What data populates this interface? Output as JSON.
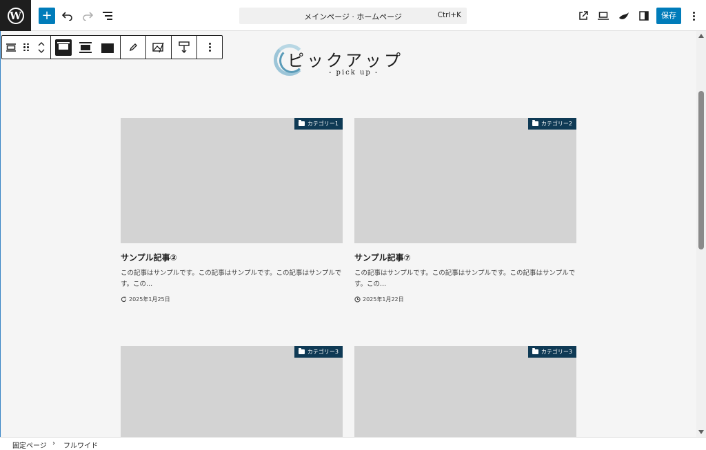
{
  "topbar": {
    "document_title": "メインページ · ホームページ",
    "shortcut": "Ctrl+K",
    "save_label": "保存"
  },
  "block_toolbar": {
    "items": [
      "cover-block",
      "drag",
      "move-up-down",
      "align-top",
      "align-center",
      "align-bottom",
      "edit",
      "replace-media",
      "change-position",
      "more-options"
    ]
  },
  "heading": {
    "title": "ピックアップ",
    "subtitle": "- pick up -"
  },
  "cards": [
    {
      "category": "カテゴリー1",
      "title": "サンプル記事②",
      "excerpt": "この記事はサンプルです。この記事はサンプルです。この記事はサンプルです。この...",
      "date_icon": "refresh-icon",
      "date": "2025年1月25日"
    },
    {
      "category": "カテゴリー2",
      "title": "サンプル記事⑦",
      "excerpt": "この記事はサンプルです。この記事はサンプルです。この記事はサンプルです。この...",
      "date_icon": "clock-icon",
      "date": "2025年1月22日"
    },
    {
      "category": "カテゴリー3"
    },
    {
      "category": "カテゴリー3"
    }
  ],
  "breadcrumb": {
    "items": [
      "固定ページ",
      "フルワイド"
    ],
    "separator": "›"
  },
  "colors": {
    "accent": "#007cba",
    "category_badge": "#0f3a55",
    "canvas_bg": "#f5f5f5",
    "thumb_placeholder": "#d3d3d3"
  }
}
